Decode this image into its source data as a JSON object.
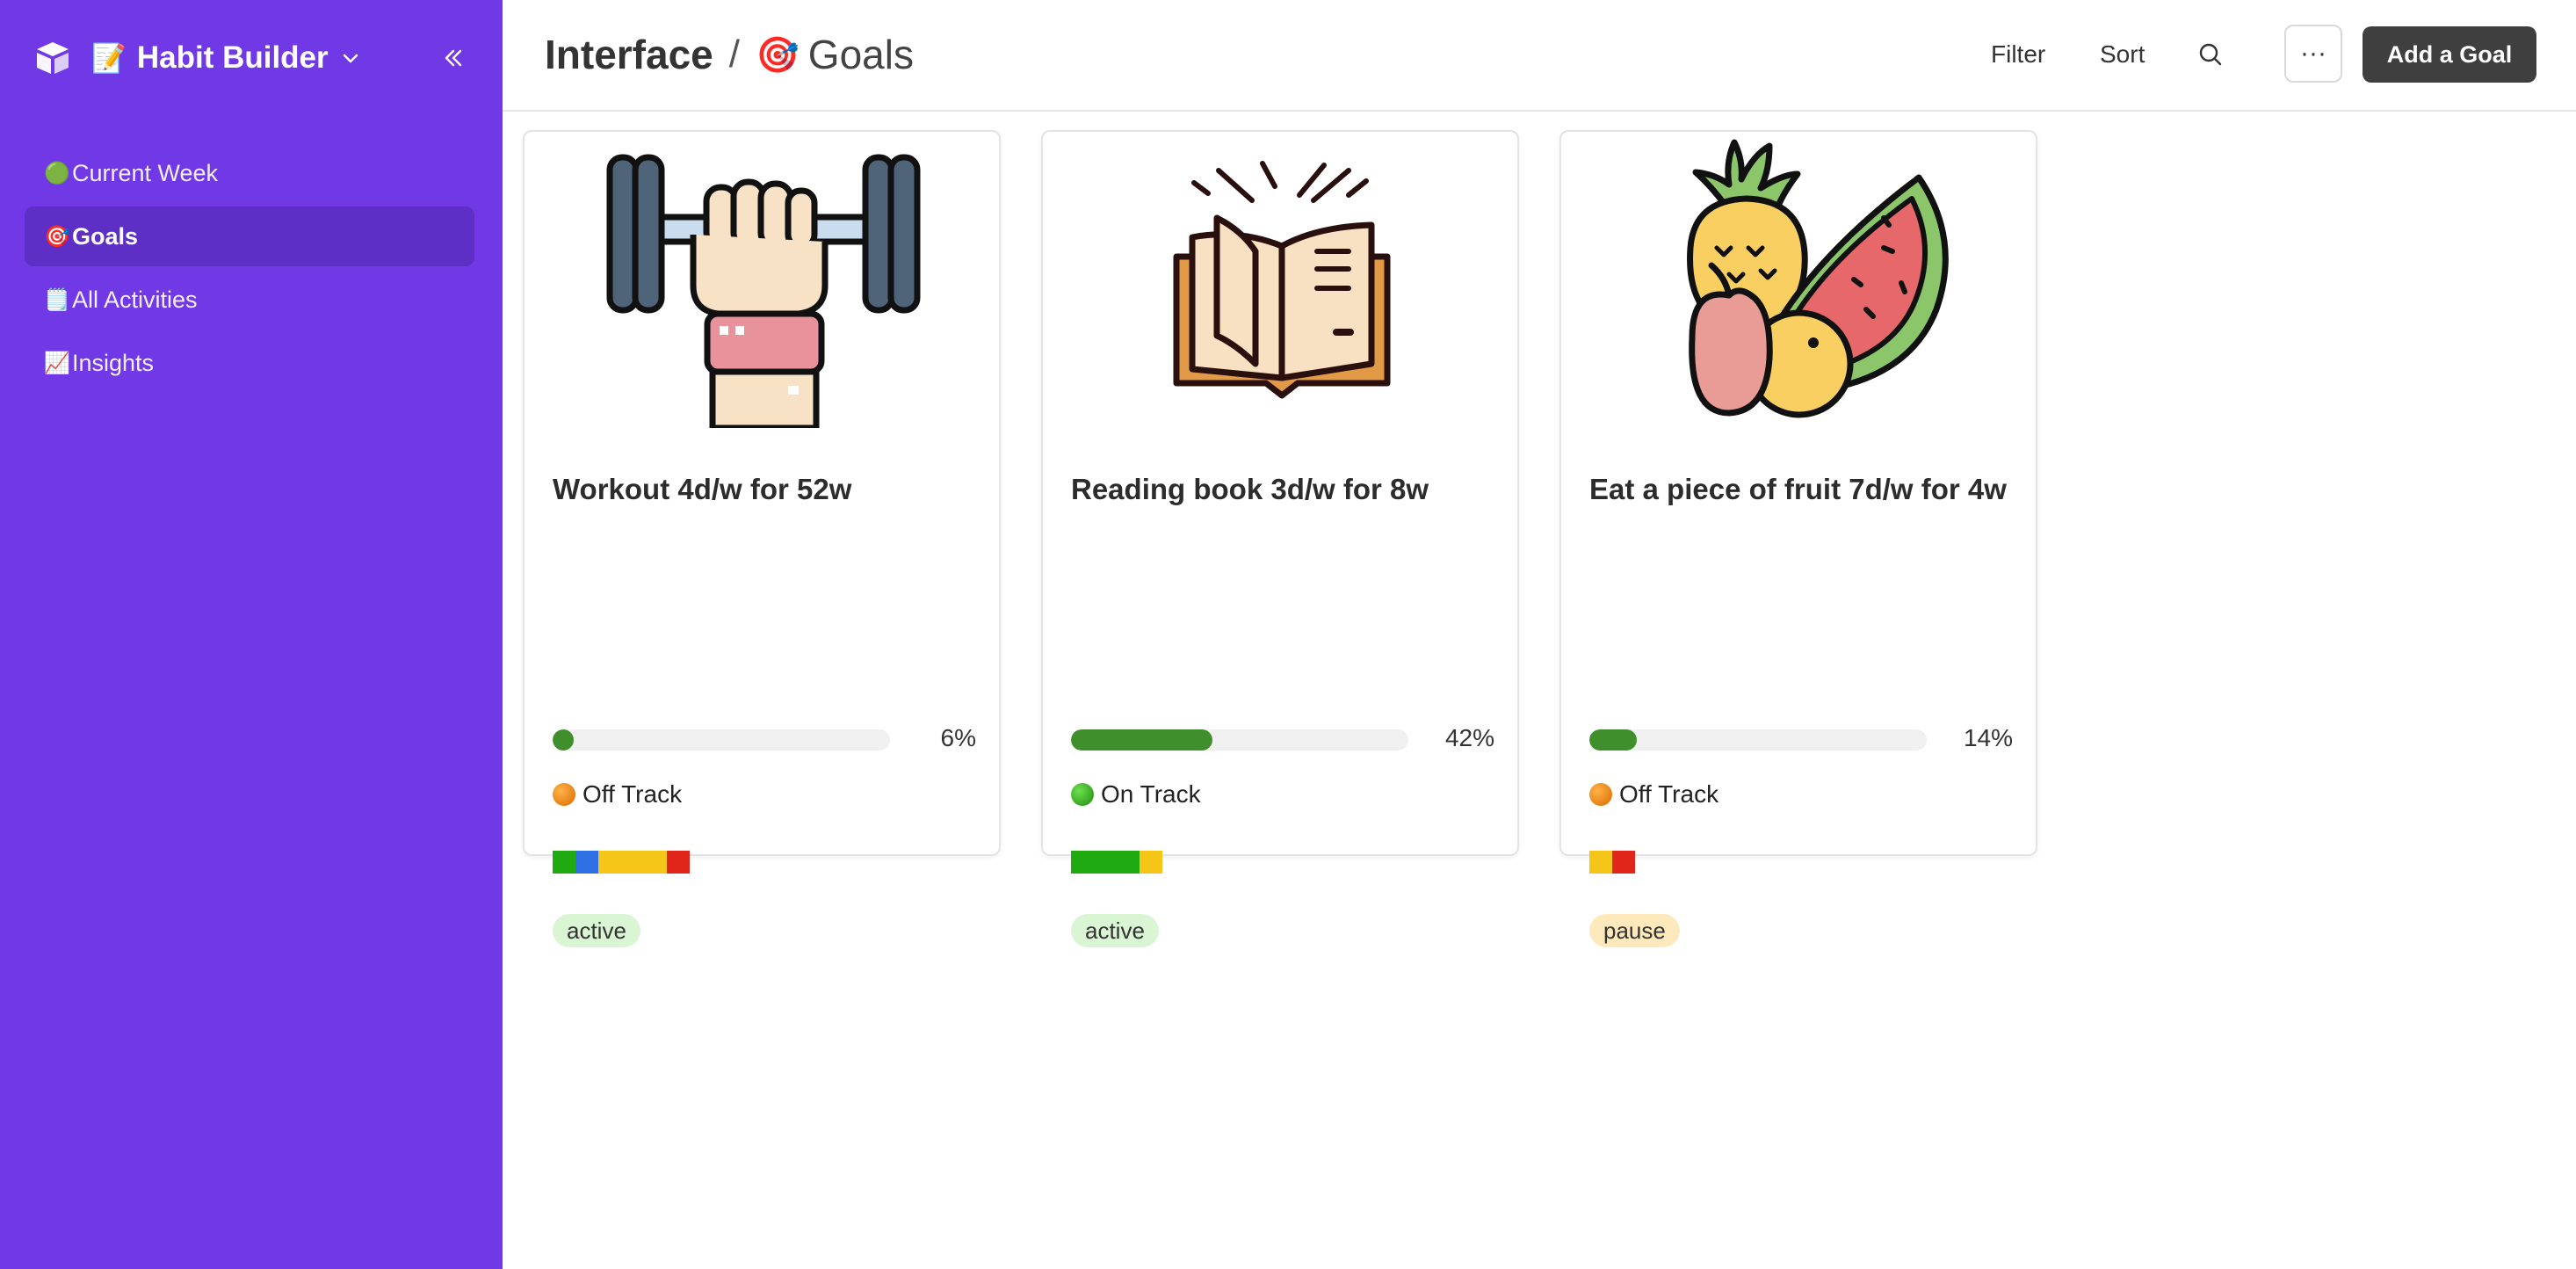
{
  "app": {
    "emoji": "📝",
    "title": "Habit Builder",
    "accent": "#7139e6"
  },
  "sidebar": {
    "items": [
      {
        "emoji": "🟢",
        "label": "Current Week",
        "active": false
      },
      {
        "emoji": "🎯",
        "label": "Goals",
        "active": true
      },
      {
        "emoji": "🗒️",
        "label": "All Activities",
        "active": false
      },
      {
        "emoji": "📈",
        "label": "Insights",
        "active": false
      }
    ]
  },
  "header": {
    "root": "Interface",
    "separator": "/",
    "page_emoji": "🎯",
    "page": "Goals",
    "filter_label": "Filter",
    "sort_label": "Sort",
    "more_label": "···",
    "add_label": "Add a Goal"
  },
  "cards": [
    {
      "image": "weightlifting-icon",
      "title": "Workout 4d/w for 52w",
      "progress": 0.06,
      "progress_label": "6%",
      "status": "Off Track",
      "status_color": "orange",
      "streak": [
        "#1faa12",
        "#2f6fe4",
        "#f5c518",
        "#f5c518",
        "#f5c518",
        "#e0261b"
      ],
      "tag": "active"
    },
    {
      "image": "open-book-icon",
      "title": "Reading book 3d/w for 8w",
      "progress": 0.42,
      "progress_label": "42%",
      "status": "On Track",
      "status_color": "green",
      "streak": [
        "#1faa12",
        "#1faa12",
        "#1faa12",
        "#f5c518"
      ],
      "tag": "active"
    },
    {
      "image": "fruit-icon",
      "title": "Eat a piece of fruit 7d/w for 4w",
      "progress": 0.14,
      "progress_label": "14%",
      "status": "Off Track",
      "status_color": "orange",
      "streak": [
        "#f5c518",
        "#e0261b"
      ],
      "tag": "pause"
    }
  ]
}
